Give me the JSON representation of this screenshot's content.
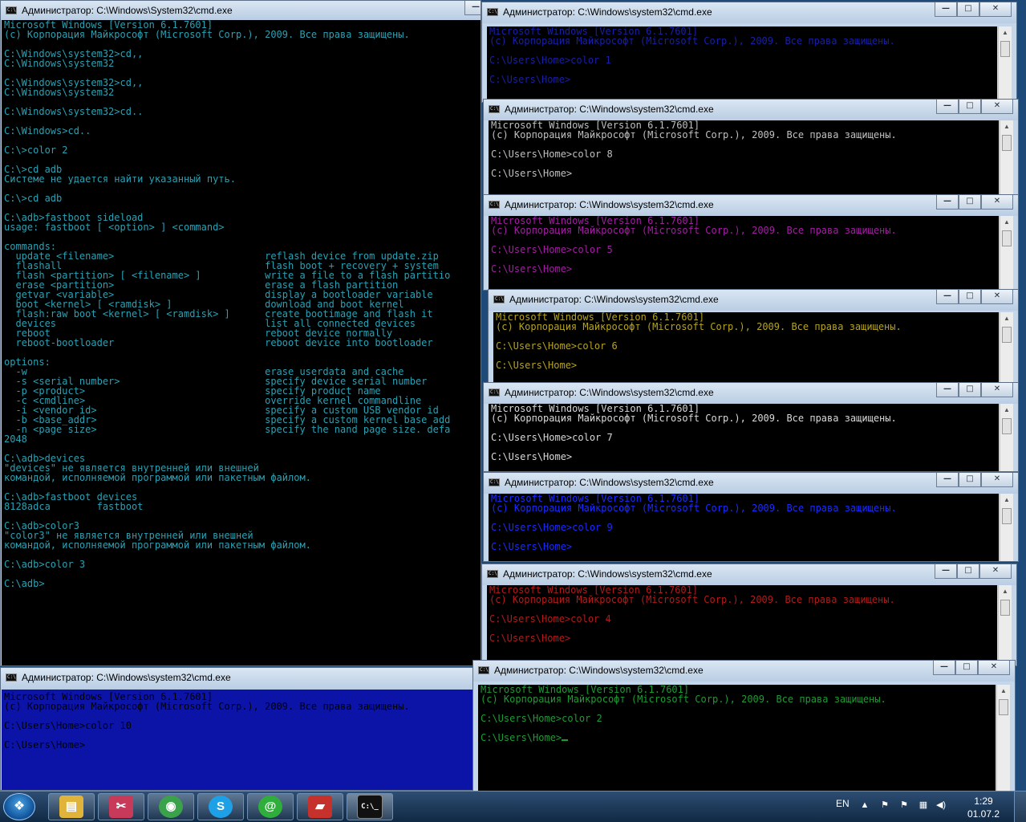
{
  "windows": [
    {
      "id": "main",
      "title": "Администратор: C:\\Windows\\System32\\cmd.exe",
      "text_color": "#2aa1b3",
      "bg_color": "#000000",
      "text": "Microsoft Windows [Version 6.1.7601]\n(c) Корпорация Майкрософт (Microsoft Corp.), 2009. Все права защищены.\n\nC:\\Windows\\system32>cd,,\nC:\\Windows\\system32\n\nC:\\Windows\\system32>cd,,\nC:\\Windows\\system32\n\nC:\\Windows\\system32>cd..\n\nC:\\Windows>cd..\n\nC:\\>color 2\n\nC:\\>cd adb\nСистеме не удается найти указанный путь.\n\nC:\\>cd adb\n\nC:\\adb>fastboot sideload\nusage: fastboot [ <option> ] <command>\n\ncommands:\n  update <filename>                          reflash device from update.zip\n  flashall                                   flash boot + recovery + system\n  flash <partition> [ <filename> ]           write a file to a flash partitio\n  erase <partition>                          erase a flash partition\n  getvar <variable>                          display a bootloader variable\n  boot <kernel> [ <ramdisk> ]                download and boot kernel\n  flash:raw boot <kernel> [ <ramdisk> ]      create bootimage and flash it\n  devices                                    list all connected devices\n  reboot                                     reboot device normally\n  reboot-bootloader                          reboot device into bootloader\n\noptions:\n  -w                                         erase userdata and cache\n  -s <serial number>                         specify device serial number\n  -p <product>                               specify product name\n  -c <cmdline>                               override kernel commandline\n  -i <vendor id>                             specify a custom USB vendor id\n  -b <base_addr>                             specify a custom kernel base add\n  -n <page size>                             specify the nand page size. defa\n2048\n\nC:\\adb>devices\n\"devices\" не является внутренней или внешней\nкомандой, исполняемой программой или пакетным файлом.\n\nC:\\adb>fastboot devices\n8128adca        fastboot\n\nC:\\adb>color3\n\"color3\" не является внутренней или внешней\nкомандой, исполняемой программой или пакетным файлом.\n\nC:\\adb>color 3\n\nC:\\adb>",
      "cursor": false
    },
    {
      "id": "color1",
      "title": "Администратор: C:\\Windows\\system32\\cmd.exe",
      "text_color": "#1a1fa6",
      "bg_color": "#000000",
      "text": "Microsoft Windows [Version 6.1.7601]\n(c) Корпорация Майкрософт (Microsoft Corp.), 2009. Все права защищены.\n\nC:\\Users\\Home>color 1\n\nC:\\Users\\Home>",
      "cursor": false
    },
    {
      "id": "color8",
      "title": "Администратор: C:\\Windows\\system32\\cmd.exe",
      "text_color": "#c0c0c0",
      "bg_color": "#000000",
      "text": "Microsoft Windows [Version 6.1.7601]\n(c) Корпорация Майкрософт (Microsoft Corp.), 2009. Все права защищены.\n\nC:\\Users\\Home>color 8\n\nC:\\Users\\Home>",
      "cursor": false
    },
    {
      "id": "color5",
      "title": "Администратор: C:\\Windows\\system32\\cmd.exe",
      "text_color": "#a31ea3",
      "bg_color": "#000000",
      "text": "Microsoft Windows [Version 6.1.7601]\n(c) Корпорация Майкрософт (Microsoft Corp.), 2009. Все права защищены.\n\nC:\\Users\\Home>color 5\n\nC:\\Users\\Home>",
      "cursor": false
    },
    {
      "id": "color6",
      "title": "Администратор: C:\\Windows\\system32\\cmd.exe",
      "text_color": "#b5a323",
      "bg_color": "#000000",
      "text": "Microsoft Windows [Version 6.1.7601]\n(c) Корпорация Майкрософт (Microsoft Corp.), 2009. Все права защищены.\n\nC:\\Users\\Home>color 6\n\nC:\\Users\\Home>",
      "cursor": false
    },
    {
      "id": "color7",
      "title": "Администратор: C:\\Windows\\system32\\cmd.exe",
      "text_color": "#d9d9d9",
      "bg_color": "#000000",
      "text": "Microsoft Windows [Version 6.1.7601]\n(c) Корпорация Майкрософт (Microsoft Corp.), 2009. Все права защищены.\n\nC:\\Users\\Home>color 7\n\nC:\\Users\\Home>",
      "cursor": false
    },
    {
      "id": "color9",
      "title": "Администратор: C:\\Windows\\system32\\cmd.exe",
      "text_color": "#1c2bff",
      "bg_color": "#000000",
      "text": "Microsoft Windows [Version 6.1.7601]\n(c) Корпорация Майкрософт (Microsoft Corp.), 2009. Все права защищены.\n\nC:\\Users\\Home>color 9\n\nC:\\Users\\Home>",
      "cursor": false
    },
    {
      "id": "color4",
      "title": "Администратор: C:\\Windows\\system32\\cmd.exe",
      "text_color": "#b11b1b",
      "bg_color": "#000000",
      "text": "Microsoft Windows [Version 6.1.7601]\n(c) Корпорация Майкрософт (Microsoft Corp.), 2009. Все права защищены.\n\nC:\\Users\\Home>color 4\n\nC:\\Users\\Home>",
      "cursor": false
    },
    {
      "id": "color10",
      "title": "Администратор: C:\\Windows\\system32\\cmd.exe",
      "text_color": "#000000",
      "bg_color": "#0c14a8",
      "text": "Microsoft Windows [Version 6.1.7601]\n(c) Корпорация Майкрософт (Microsoft Corp.), 2009. Все права защищены.\n\nC:\\Users\\Home>color 10\n\nC:\\Users\\Home>",
      "cursor": false
    },
    {
      "id": "color2",
      "title": "Администратор: C:\\Windows\\system32\\cmd.exe",
      "text_color": "#1e9b33",
      "bg_color": "#000000",
      "text": "Microsoft Windows [Version 6.1.7601]\n(c) Корпорация Майкрософт (Microsoft Corp.), 2009. Все права защищены.\n\nC:\\Users\\Home>color 2\n\nC:\\Users\\Home>",
      "cursor": true
    }
  ],
  "window_controls": {
    "minimize": "—",
    "maximize": "□",
    "close": "✕"
  },
  "taskbar": {
    "start_icon": "windows-orb-icon",
    "apps": [
      {
        "name": "explorer-icon",
        "glyph": "▤",
        "color": "#e0b43a"
      },
      {
        "name": "scissors-icon",
        "glyph": "✂",
        "color": "#c83a5a"
      },
      {
        "name": "chrome-icon",
        "glyph": "◉",
        "color": "#3aa24a"
      },
      {
        "name": "skype-icon",
        "glyph": "S",
        "color": "#1ea0e6"
      },
      {
        "name": "mail-agent-icon",
        "glyph": "@",
        "color": "#2fae3b"
      },
      {
        "name": "toolbox-icon",
        "glyph": "▰",
        "color": "#c7312b"
      },
      {
        "name": "cmd-icon",
        "glyph": "C:\\_",
        "color": "#111111"
      }
    ],
    "language": "EN",
    "tray": {
      "arrow": "▲",
      "flag": "⚑",
      "network": "▦",
      "volume": "◀)"
    },
    "time": "1:29",
    "date": "01.07.2"
  }
}
